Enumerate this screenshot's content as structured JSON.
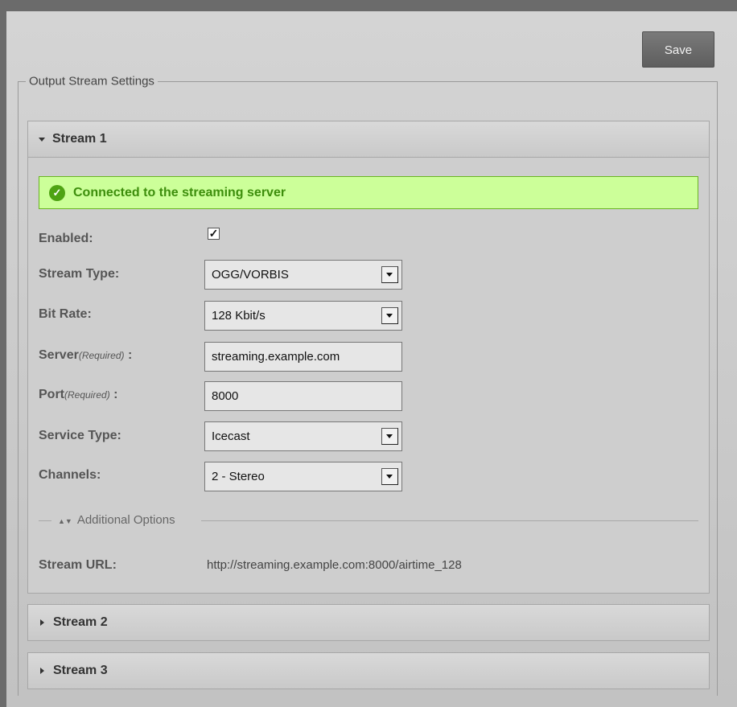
{
  "toolbar": {
    "save_label": "Save"
  },
  "fieldset": {
    "legend": "Output Stream Settings"
  },
  "streams": [
    {
      "title": "Stream 1",
      "expanded": true
    },
    {
      "title": "Stream 2",
      "expanded": false
    },
    {
      "title": "Stream 3",
      "expanded": false
    }
  ],
  "stream1": {
    "status": "Connected to the streaming server",
    "enabled_label": "Enabled:",
    "enabled": true,
    "stream_type_label": "Stream Type:",
    "stream_type": "OGG/VORBIS",
    "bit_rate_label": "Bit Rate:",
    "bit_rate": "128 Kbit/s",
    "server_label": "Server",
    "server_required": "(Required)",
    "server_suffix": " :",
    "server": "streaming.example.com",
    "port_label": "Port",
    "port_required": "(Required)",
    "port_suffix": " :",
    "port": "8000",
    "service_type_label": "Service Type:",
    "service_type": "Icecast",
    "channels_label": "Channels:",
    "channels": "2 - Stereo",
    "additional_options": "Additional Options",
    "stream_url_label": "Stream URL:",
    "stream_url": "http://streaming.example.com:8000/airtime_128"
  },
  "colors": {
    "success_bg": "#ccff99",
    "success_text": "#3d8e0c",
    "save_button": "#6a6a6a"
  },
  "icons": {
    "expanded": "triangle-down-icon",
    "collapsed": "triangle-right-icon",
    "status": "check-circle-icon",
    "dropdown": "dropdown-arrow-icon"
  }
}
